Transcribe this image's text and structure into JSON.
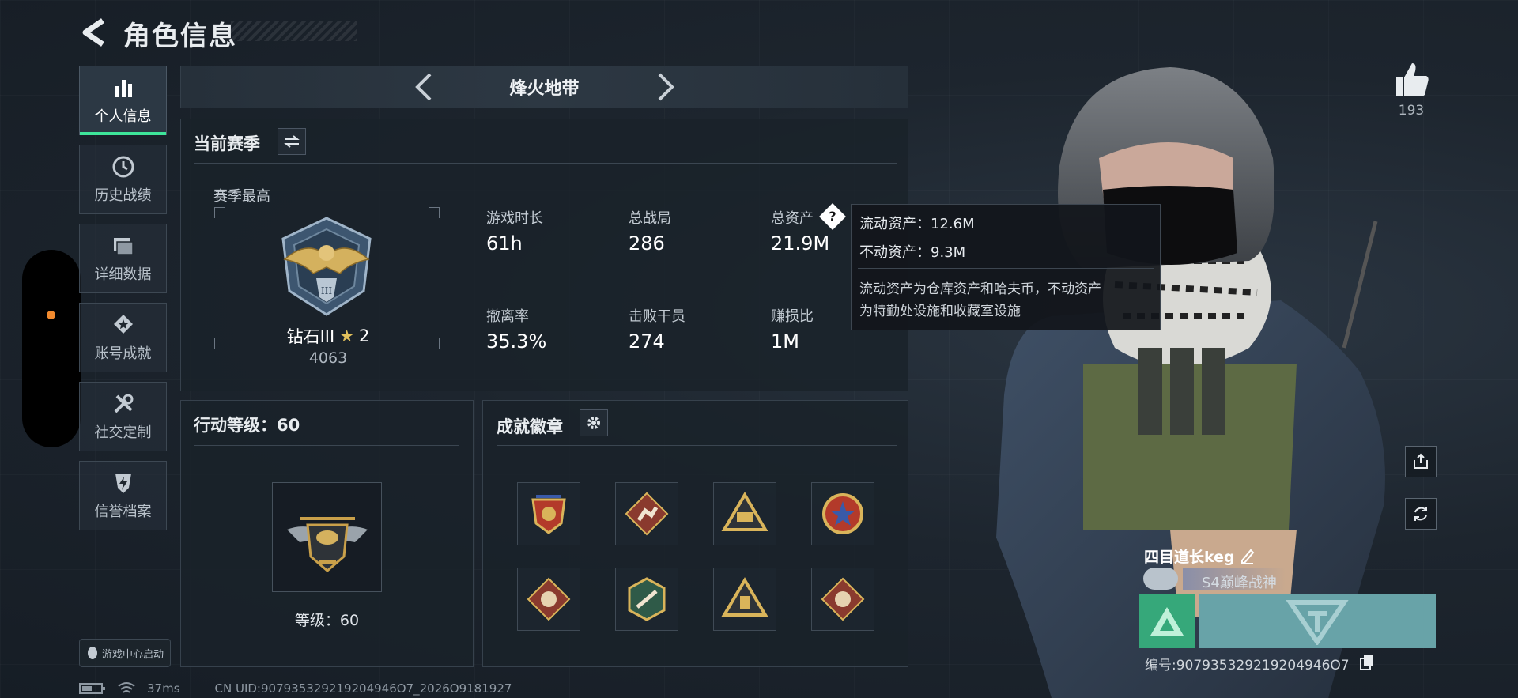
{
  "header": {
    "title": "角色信息"
  },
  "sidebar": {
    "items": [
      {
        "label": "个人信息",
        "icon": "bar-chart-icon",
        "active": true
      },
      {
        "label": "历史战绩",
        "icon": "history-icon"
      },
      {
        "label": "详细数据",
        "icon": "folders-icon"
      },
      {
        "label": "账号成就",
        "icon": "medal-icon"
      },
      {
        "label": "社交定制",
        "icon": "tools-icon"
      },
      {
        "label": "信誉档案",
        "icon": "shield-bolt-icon"
      }
    ]
  },
  "launcher": {
    "label": "游戏中心启动",
    "icon": "penguin-icon"
  },
  "status": {
    "ping": "37ms",
    "uid": "CN UID:907935329219204946O7_2026O9181927"
  },
  "mode": {
    "name": "烽火地带"
  },
  "season": {
    "title": "当前赛季",
    "best_label": "赛季最高",
    "rank_name": "钻石III",
    "rank_stars": "2",
    "rank_points": "4063",
    "stats": [
      {
        "label": "游戏时长",
        "value": "61h"
      },
      {
        "label": "总战局",
        "value": "286"
      },
      {
        "label": "总资产",
        "value": "21.9M"
      },
      {
        "label": "撤离率",
        "value": "35.3%"
      },
      {
        "label": "击败干员",
        "value": "274"
      },
      {
        "label": "赚损比",
        "value": "1M"
      }
    ]
  },
  "tooltip": {
    "liquid": "流动资产：12.6M",
    "fixed": "不动资产：9.3M",
    "desc_line1": "流动资产为仓库资产和哈夫币，不动资产",
    "desc_line2": "为特勤处设施和收藏室设施"
  },
  "action_level": {
    "title": "行动等级：60",
    "level_label": "等级：60"
  },
  "badges": {
    "title": "成就徽章",
    "count": 8
  },
  "player": {
    "likes": "193",
    "name": "四目道长keg",
    "honor": "S4巅峰战神",
    "id": "编号:907935329219204946O7"
  },
  "colors": {
    "accent": "#3ee59a",
    "tooltip_bg": "#12161b",
    "gold": "#c9a04a",
    "status_dot": "#f28a2e"
  }
}
